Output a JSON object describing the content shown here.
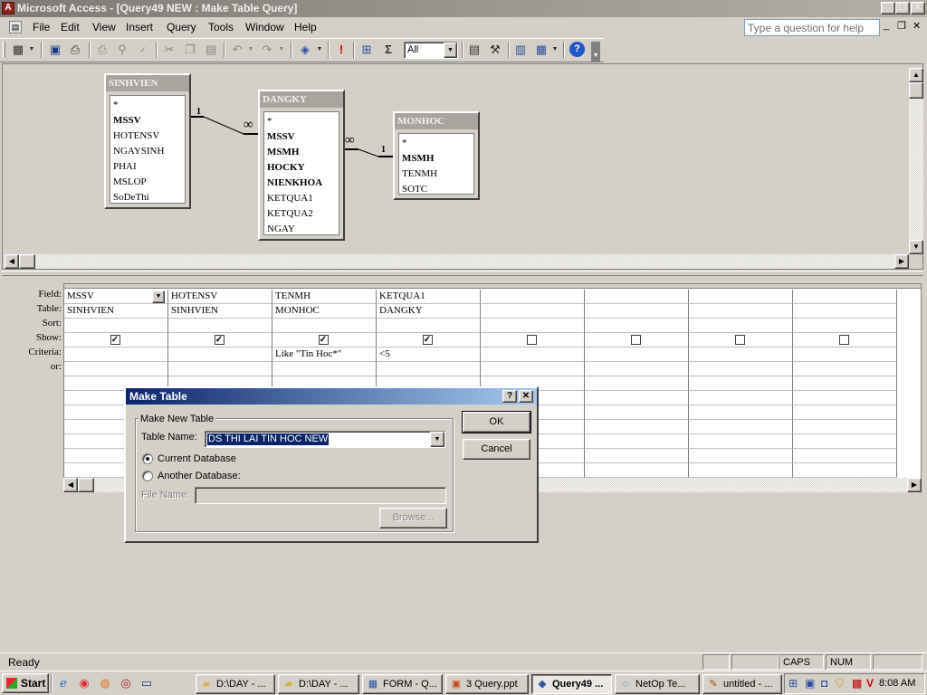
{
  "window": {
    "title": "Microsoft Access - [Query49 NEW : Make Table Query]",
    "app_icon": "access-key-icon",
    "minimize": "_",
    "restore": "❐",
    "close": "✕"
  },
  "menu": {
    "items": [
      "File",
      "Edit",
      "View",
      "Insert",
      "Query",
      "Tools",
      "Window",
      "Help"
    ],
    "help_placeholder": "Type a question for help"
  },
  "toolbar": {
    "top_values": "All",
    "icons": [
      "view-icon",
      "save-icon",
      "print-preview-icon",
      "print-icon",
      "spelling-icon",
      "cut-icon",
      "copy-icon",
      "paste-icon",
      "undo-icon",
      "redo-icon",
      "query-type-icon",
      "run-icon",
      "show-table-icon",
      "totals-icon",
      "properties-icon",
      "build-icon",
      "database-window-icon",
      "new-object-icon",
      "help-icon"
    ]
  },
  "tables": [
    {
      "name": "SINHVIEN",
      "fields": [
        "*",
        "MSSV",
        "HOTENSV",
        "NGAYSINH",
        "PHAI",
        "MSLOP",
        "SoDeThi"
      ],
      "key_fields": [
        "MSSV"
      ]
    },
    {
      "name": "DANGKY",
      "fields": [
        "*",
        "MSSV",
        "MSMH",
        "HOCKY",
        "NIENKHOA",
        "KETQUA1",
        "KETQUA2",
        "NGAY"
      ],
      "key_fields": [
        "MSSV",
        "MSMH",
        "HOCKY",
        "NIENKHOA"
      ]
    },
    {
      "name": "MONHOC",
      "fields": [
        "*",
        "MSMH",
        "TENMH",
        "SOTC"
      ],
      "key_fields": [
        "MSMH"
      ]
    }
  ],
  "relationships": [
    {
      "from": "SINHVIEN",
      "to": "DANGKY",
      "from_label": "1",
      "to_label": "∞"
    },
    {
      "from": "DANGKY",
      "to": "MONHOC",
      "from_label": "∞",
      "to_label": "1"
    }
  ],
  "grid": {
    "row_labels": [
      "Field:",
      "Table:",
      "Sort:",
      "Show:",
      "Criteria:",
      "or:"
    ],
    "columns": [
      {
        "field": "MSSV",
        "table": "SINHVIEN",
        "sort": "",
        "show": true,
        "criteria": "",
        "or": ""
      },
      {
        "field": "HOTENSV",
        "table": "SINHVIEN",
        "sort": "",
        "show": true,
        "criteria": "",
        "or": ""
      },
      {
        "field": "TENMH",
        "table": "MONHOC",
        "sort": "",
        "show": true,
        "criteria": "Like \"Tin Hoc*\"",
        "or": ""
      },
      {
        "field": "KETQUA1",
        "table": "DANGKY",
        "sort": "",
        "show": true,
        "criteria": "<5",
        "or": ""
      },
      {
        "field": "",
        "table": "",
        "sort": "",
        "show": false,
        "criteria": "",
        "or": ""
      },
      {
        "field": "",
        "table": "",
        "sort": "",
        "show": false,
        "criteria": "",
        "or": ""
      },
      {
        "field": "",
        "table": "",
        "sort": "",
        "show": false,
        "criteria": "",
        "or": ""
      },
      {
        "field": "",
        "table": "",
        "sort": "",
        "show": false,
        "criteria": "",
        "or": ""
      }
    ]
  },
  "dialog": {
    "title": "Make Table",
    "help": "?",
    "close": "✕",
    "group_label": "Make New Table",
    "table_name_label": "Table Name:",
    "table_name_value": "DS THI LAI TIN HOC NEW",
    "current_db_label": "Current Database",
    "another_db_label": "Another Database:",
    "current_db_selected": true,
    "file_name_label": "File Name:",
    "file_name_value": "",
    "browse_label": "Browse...",
    "ok_label": "OK",
    "cancel_label": "Cancel"
  },
  "status": {
    "text": "Ready",
    "caps": "CAPS",
    "num": "NUM"
  },
  "taskbar": {
    "start": "Start",
    "tasks": [
      {
        "label": "D:\\DAY - ...",
        "icon": "folder-icon",
        "active": false
      },
      {
        "label": "D:\\DAY - ...",
        "icon": "folder-icon",
        "active": false
      },
      {
        "label": "FORM - Q...",
        "icon": "access-form-icon",
        "active": false
      },
      {
        "label": "3 Query.ppt",
        "icon": "powerpoint-icon",
        "active": false
      },
      {
        "label": "Query49 ...",
        "icon": "access-query-icon",
        "active": true
      },
      {
        "label": "NetOp Te...",
        "icon": "netop-icon",
        "active": false
      },
      {
        "label": "untitled - ...",
        "icon": "paint-icon",
        "active": false
      }
    ],
    "clock": "8:08 AM"
  }
}
